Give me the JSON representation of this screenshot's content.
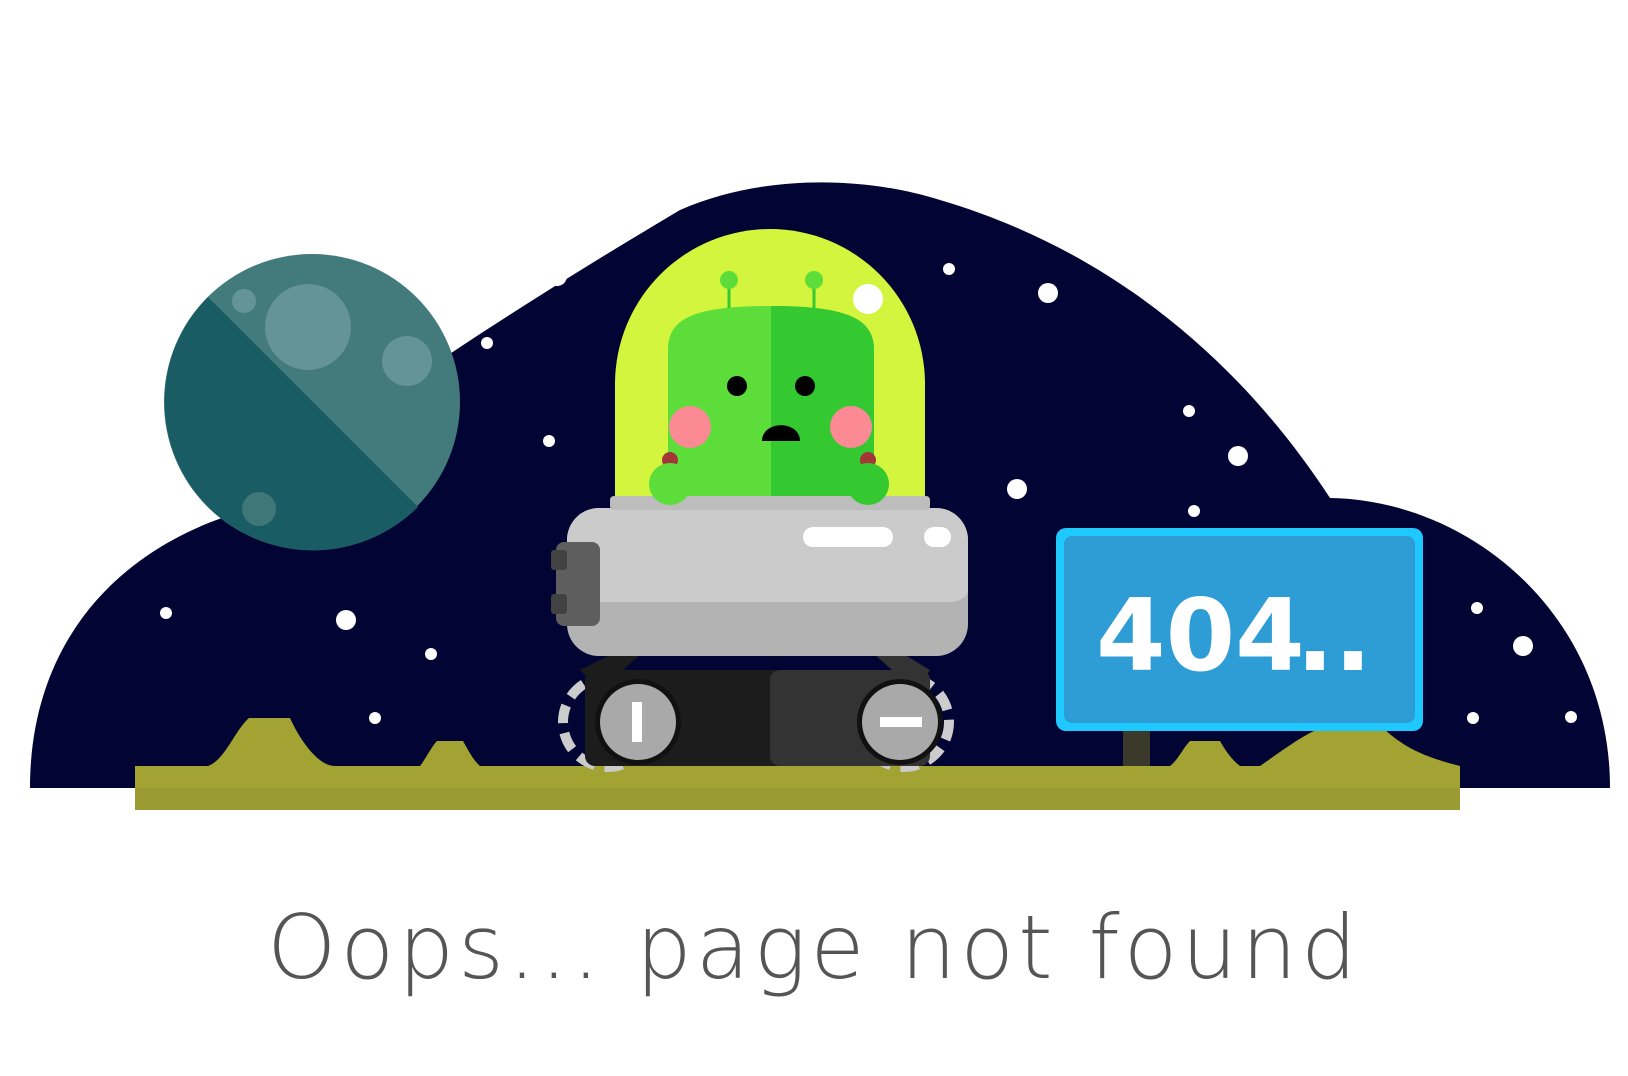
{
  "sign": {
    "code": "404",
    "dots": ".."
  },
  "message": "Oops... page not found",
  "colors": {
    "sky": "#020433",
    "ground": "#a3a333",
    "sign_face": "#2e9dd6",
    "sign_border": "#1fc8ff",
    "alien_body": "#5ddd3a",
    "dome": "#d4f53d",
    "planet": "#437a7c",
    "text": "#555555"
  }
}
